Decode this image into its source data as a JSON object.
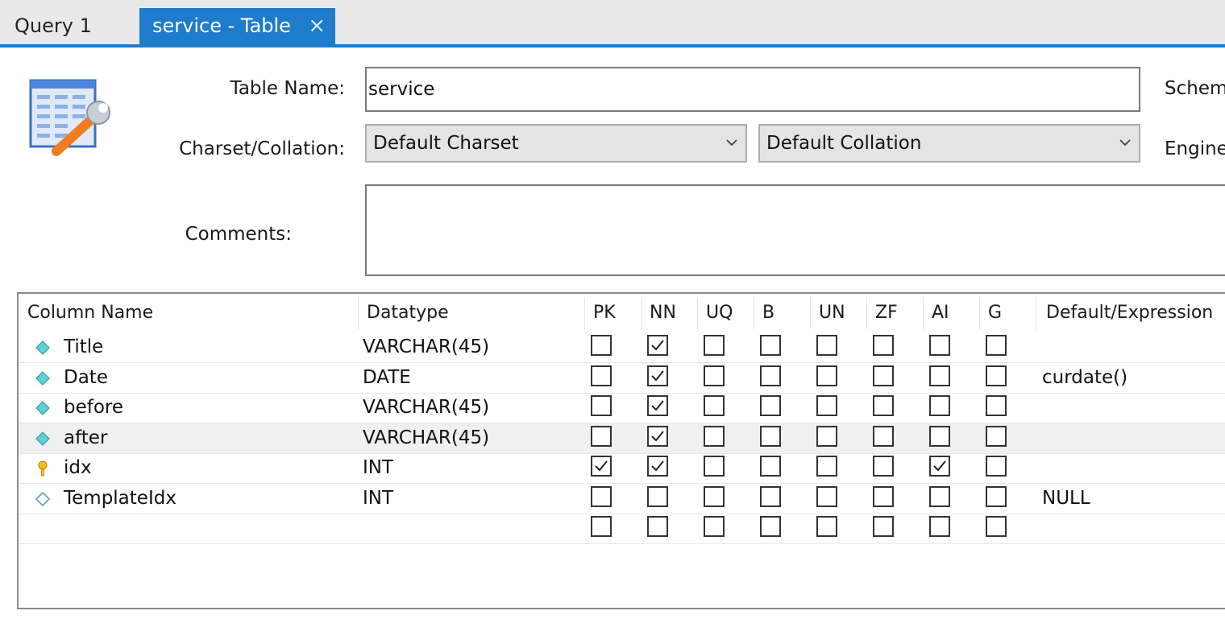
{
  "tabs": [
    {
      "label": "Query 1",
      "active": false
    },
    {
      "label": "service - Table",
      "active": true,
      "close": "×"
    }
  ],
  "form": {
    "table_name_label": "Table Name:",
    "table_name_value": "service",
    "charset_label": "Charset/Collation:",
    "charset_value": "Default Charset",
    "collation_value": "Default Collation",
    "comments_label": "Comments:",
    "comments_value": "",
    "schema_label": "Schem",
    "engine_label": "Engine"
  },
  "grid": {
    "headers": {
      "column_name": "Column Name",
      "datatype": "Datatype",
      "pk": "PK",
      "nn": "NN",
      "uq": "UQ",
      "b": "B",
      "un": "UN",
      "zf": "ZF",
      "ai": "AI",
      "g": "G",
      "default": "Default/Expression"
    },
    "rows": [
      {
        "name": "Title",
        "datatype": "VARCHAR(45)",
        "icon": "column-diamond-icon",
        "flags": [
          false,
          true,
          false,
          false,
          false,
          false,
          false,
          false
        ],
        "default": ""
      },
      {
        "name": "Date",
        "datatype": "DATE",
        "icon": "column-diamond-icon",
        "flags": [
          false,
          true,
          false,
          false,
          false,
          false,
          false,
          false
        ],
        "default": "curdate()"
      },
      {
        "name": "before",
        "datatype": "VARCHAR(45)",
        "icon": "column-diamond-icon",
        "flags": [
          false,
          true,
          false,
          false,
          false,
          false,
          false,
          false
        ],
        "default": ""
      },
      {
        "name": "after",
        "datatype": "VARCHAR(45)",
        "icon": "column-diamond-icon",
        "flags": [
          false,
          true,
          false,
          false,
          false,
          false,
          false,
          false
        ],
        "default": "",
        "selected": true
      },
      {
        "name": "idx",
        "datatype": "INT",
        "icon": "primary-key-icon",
        "flags": [
          true,
          true,
          false,
          false,
          false,
          false,
          true,
          false
        ],
        "default": ""
      },
      {
        "name": "TemplateIdx",
        "datatype": "INT",
        "icon": "nullable-column-diamond-icon",
        "flags": [
          false,
          false,
          false,
          false,
          false,
          false,
          false,
          false
        ],
        "default": "NULL"
      },
      {
        "name": "",
        "datatype": "",
        "icon": "",
        "flags": [
          false,
          false,
          false,
          false,
          false,
          false,
          false,
          false
        ],
        "default": ""
      }
    ]
  },
  "colors": {
    "accent": "#1f7bcc",
    "diamond": "#5fd0d6",
    "key": "#f0c419"
  }
}
